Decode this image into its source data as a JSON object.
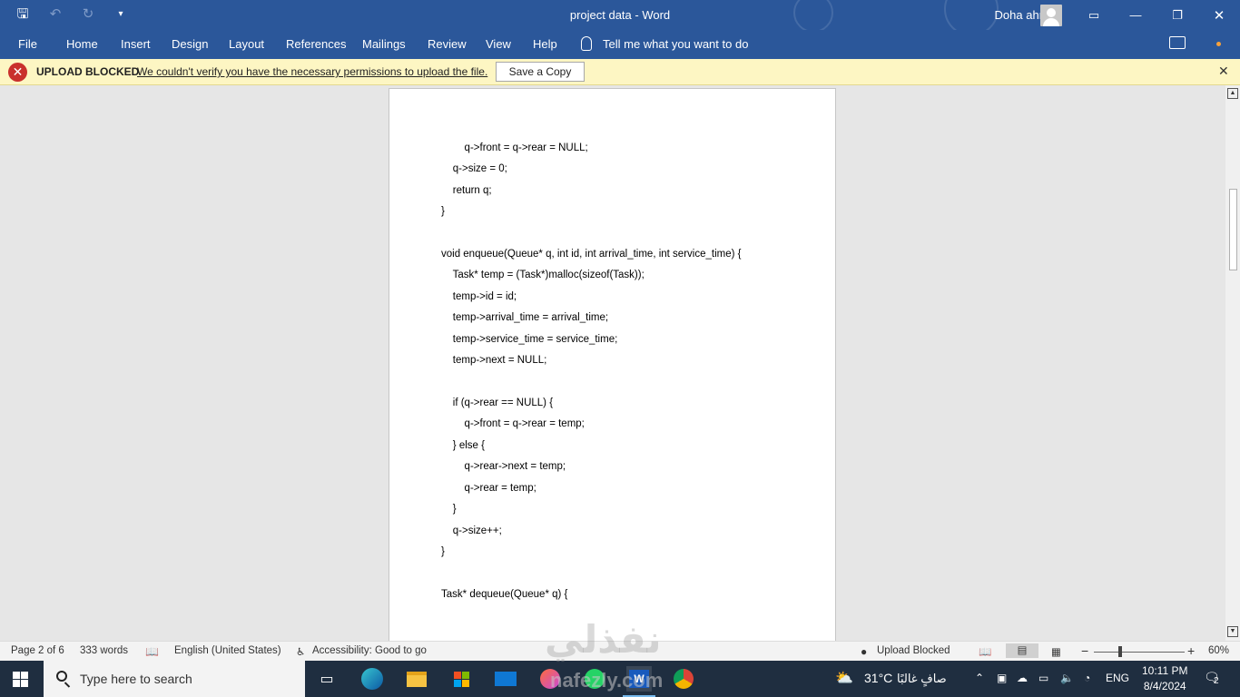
{
  "titlebar": {
    "title": "project data  -  Word",
    "user": "Doha ahmed",
    "qat": {
      "save_icon": "save-icon",
      "undo_icon": "undo-icon",
      "redo_icon": "redo-icon",
      "customize_icon": "chevron-down-icon"
    }
  },
  "ribbon": {
    "tabs": [
      "File",
      "Home",
      "Insert",
      "Design",
      "Layout",
      "References",
      "Mailings",
      "Review",
      "View",
      "Help"
    ],
    "tell_me": "Tell me what you want to do"
  },
  "message_bar": {
    "title": "UPLOAD BLOCKED",
    "text": "We couldn't verify you have the necessary permissions to upload the file.",
    "button": "Save a Copy",
    "close": "✕"
  },
  "document": {
    "lines": [
      "    q->front = q->rear = NULL;",
      "    q->size = 0;",
      "    return q;",
      "}",
      "",
      "void enqueue(Queue* q, int id, int arrival_time, int service_time) {",
      "    Task* temp = (Task*)malloc(sizeof(Task));",
      "    temp->id = id;",
      "    temp->arrival_time = arrival_time;",
      "    temp->service_time = service_time;",
      "    temp->next = NULL;",
      "",
      "    if (q->rear == NULL) {",
      "        q->front = q->rear = temp;",
      "    } else {",
      "        q->rear->next = temp;",
      "        q->rear = temp;",
      "    }",
      "    q->size++;",
      "}",
      "",
      "Task* dequeue(Queue* q) {"
    ]
  },
  "statusbar": {
    "page": "Page 2 of 6",
    "words": "333 words",
    "language": "English (United States)",
    "accessibility": "Accessibility: Good to go",
    "upload_status": "Upload Blocked",
    "zoom_minus": "−",
    "zoom_plus": "+",
    "zoom": "60%"
  },
  "taskbar": {
    "search_placeholder": "Type here to search",
    "weather_temp": "31°C",
    "weather_text": "صافٍ غالبًا",
    "lang": "ENG",
    "time": "10:11 PM",
    "date": "8/4/2024",
    "notifications": "2"
  },
  "watermark": {
    "arabic": "نفذلي",
    "latin": "nafezly.com"
  },
  "colors": {
    "word_blue": "#2b579a",
    "message_bg": "#fdf6c3",
    "error_red": "#c9302c",
    "taskbar": "#1f2e40"
  }
}
